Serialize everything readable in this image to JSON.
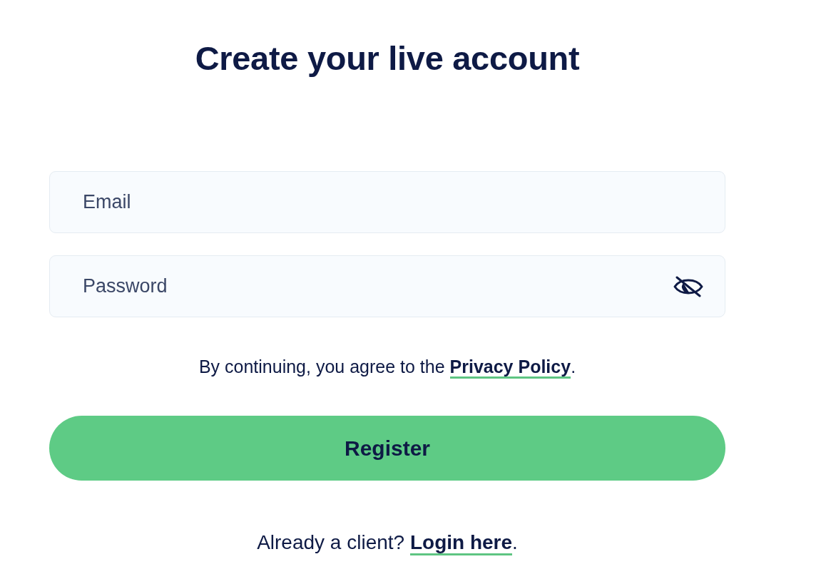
{
  "title": "Create your live account",
  "fields": [
    {
      "kind": "email",
      "placeholder": "Email"
    },
    {
      "kind": "password",
      "placeholder": "Password"
    }
  ],
  "consent": {
    "text": "By continuing, you agree to the",
    "link": "Privacy Policy",
    "after": "."
  },
  "register_button": "Register",
  "login_prompt": {
    "text": "Already a client?",
    "link": "Login here",
    "after": "."
  }
}
